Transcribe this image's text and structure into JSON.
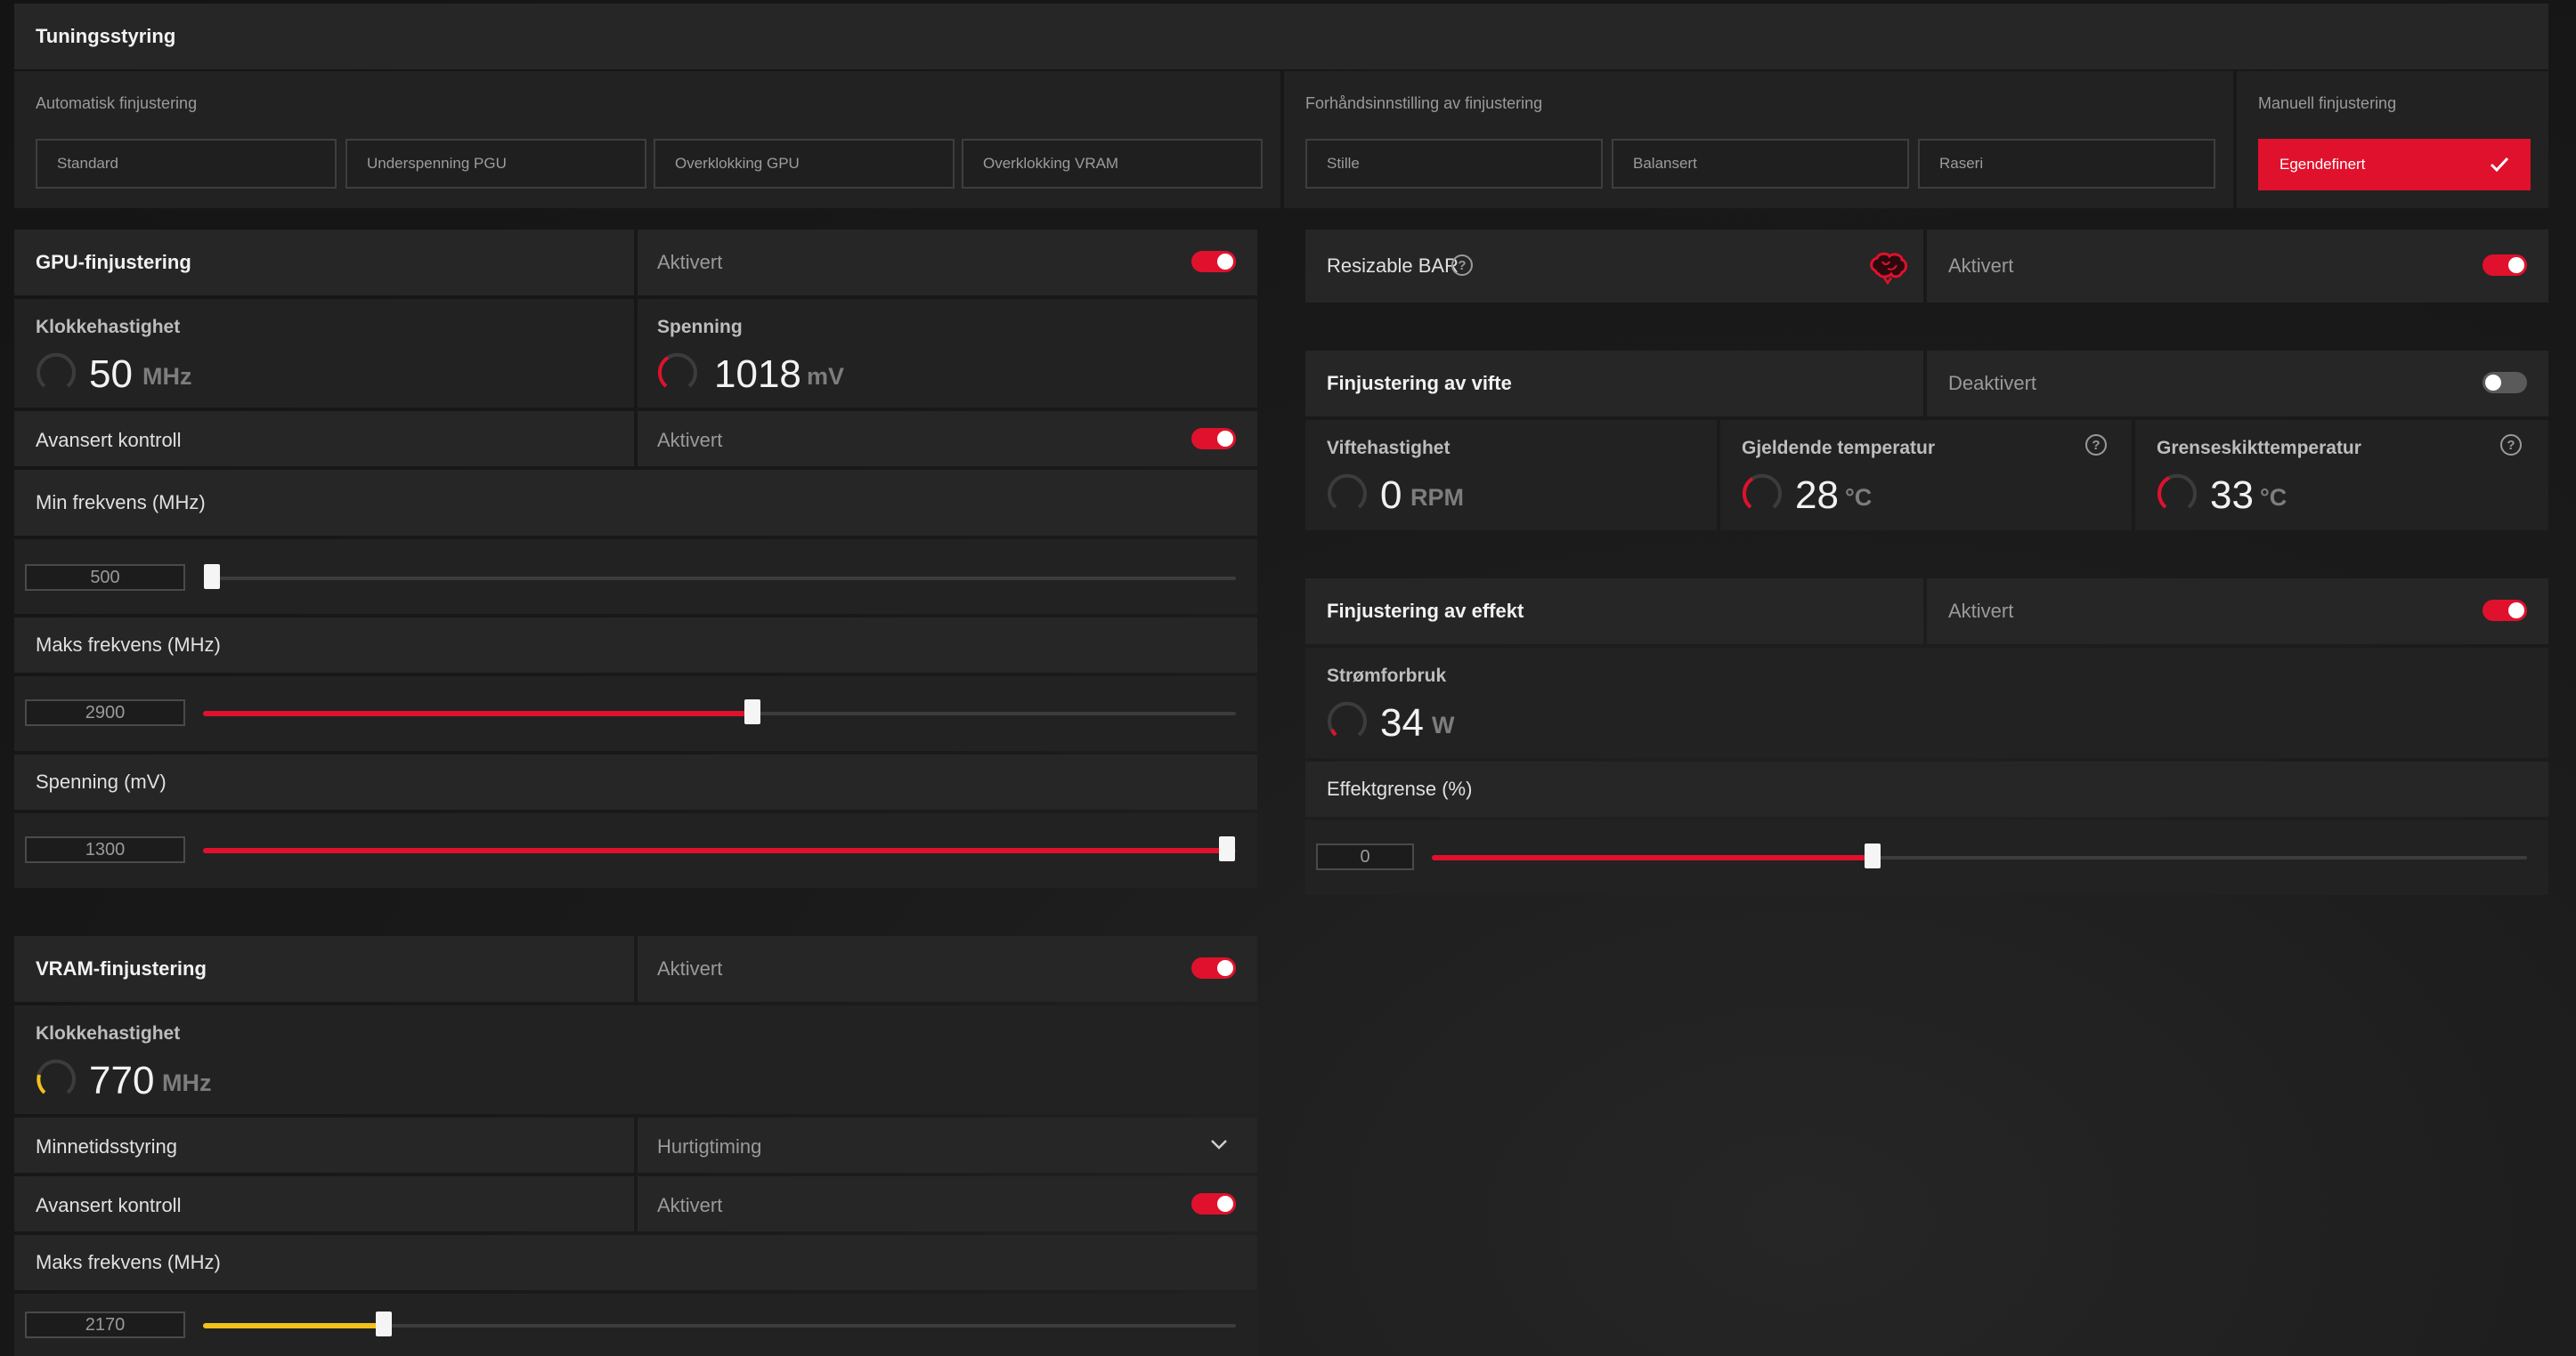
{
  "tuning_control": {
    "title": "Tuningsstyring",
    "auto": {
      "label": "Automatisk finjustering",
      "buttons": [
        "Standard",
        "Underspenning PGU",
        "Overklokking GPU",
        "Overklokking VRAM"
      ]
    },
    "preset": {
      "label": "Forhåndsinnstilling av finjustering",
      "buttons": [
        "Stille",
        "Balansert",
        "Raseri"
      ]
    },
    "manual": {
      "label": "Manuell finjustering",
      "button": "Egendefinert"
    }
  },
  "gpu_tuning": {
    "title": "GPU-finjustering",
    "status": "Aktivert",
    "clock": {
      "label": "Klokkehastighet",
      "value": "50",
      "unit": "MHz"
    },
    "voltage": {
      "label": "Spenning",
      "value": "1018",
      "unit": "mV"
    },
    "advanced": {
      "label": "Avansert kontroll",
      "status": "Aktivert"
    },
    "min_freq": {
      "label": "Min frekvens (MHz)",
      "value": "500",
      "fraction": 0.0
    },
    "max_freq": {
      "label": "Maks frekvens (MHz)",
      "value": "2900",
      "fraction": 0.53
    },
    "volt_slider": {
      "label": "Spenning (mV)",
      "value": "1300",
      "fraction": 1.0
    }
  },
  "vram_tuning": {
    "title": "VRAM-finjustering",
    "status": "Aktivert",
    "clock": {
      "label": "Klokkehastighet",
      "value": "770",
      "unit": "MHz"
    },
    "timing": {
      "label": "Minnetidsstyring",
      "value": "Hurtigtiming"
    },
    "advanced": {
      "label": "Avansert kontroll",
      "status": "Aktivert"
    },
    "max_freq": {
      "label": "Maks frekvens (MHz)",
      "value": "2170",
      "fraction": 0.18
    }
  },
  "resizable_bar": {
    "label": "Resizable BAR",
    "status": "Aktivert"
  },
  "fan_tuning": {
    "title": "Finjustering av vifte",
    "status": "Deaktivert",
    "fan_speed": {
      "label": "Viftehastighet",
      "value": "0",
      "unit": "RPM"
    },
    "current_temp": {
      "label": "Gjeldende temperatur",
      "value": "28",
      "unit": "°C"
    },
    "junction_temp": {
      "label": "Grenseskikttemperatur",
      "value": "33",
      "unit": "°C"
    }
  },
  "power_tuning": {
    "title": "Finjustering av effekt",
    "status": "Aktivert",
    "consumption": {
      "label": "Strømforbruk",
      "value": "34",
      "unit": "W"
    },
    "limit": {
      "label": "Effektgrense (%)",
      "value": "0",
      "fraction": 0.4
    }
  },
  "colors": {
    "accent": "#e0112c",
    "vram_accent": "#f2c21b",
    "panel": "#222222"
  }
}
